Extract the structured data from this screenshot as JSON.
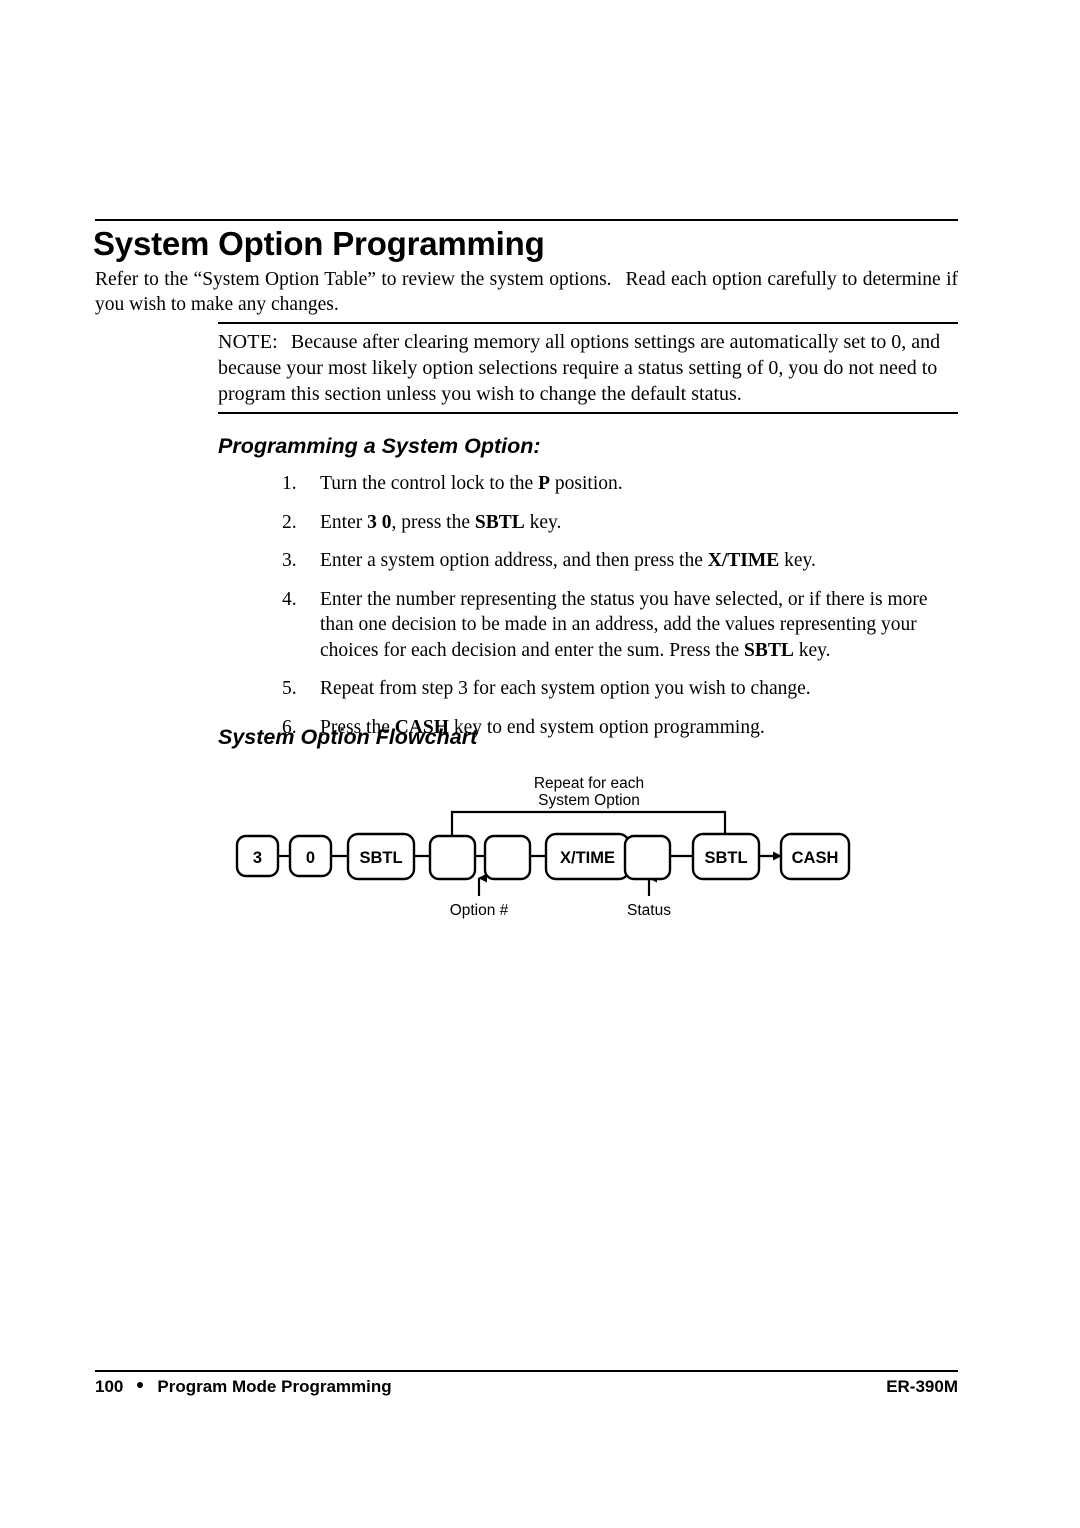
{
  "page": {
    "title": "System Option Programming",
    "intro_part1": "Refer to the “System Option Table” to review the system options.",
    "intro_part2": "Read each option carefully to determine if you wish to make any changes."
  },
  "note": {
    "label": "NOTE:",
    "text": "Because after clearing memory all options settings are automatically set to 0, and because your most likely option selections require a status setting of 0, you do not need to program this section unless you wish to change the default status."
  },
  "section_programming": {
    "heading": "Programming a System Option:",
    "steps": [
      {
        "number": "1.",
        "parts": [
          {
            "text": "Turn the control lock to the ",
            "bold": false
          },
          {
            "text": "P",
            "bold": true
          },
          {
            "text": " position.",
            "bold": false
          }
        ]
      },
      {
        "number": "2.",
        "parts": [
          {
            "text": "Enter ",
            "bold": false
          },
          {
            "text": "3 0",
            "bold": true
          },
          {
            "text": ", press the ",
            "bold": false
          },
          {
            "text": "SBTL",
            "bold": true
          },
          {
            "text": " key.",
            "bold": false
          }
        ]
      },
      {
        "number": "3.",
        "parts": [
          {
            "text": "Enter a system option address, and then press the ",
            "bold": false
          },
          {
            "text": "X/TIME",
            "bold": true
          },
          {
            "text": " key.",
            "bold": false
          }
        ]
      },
      {
        "number": "4.",
        "parts": [
          {
            "text": "Enter the number representing the status you have selected, or if there is more than one decision to be made in an address, add the values representing your choices for each decision and enter the sum. Press the ",
            "bold": false
          },
          {
            "text": "SBTL",
            "bold": true
          },
          {
            "text": " key.",
            "bold": false
          }
        ]
      },
      {
        "number": "5.",
        "parts": [
          {
            "text": "Repeat from step 3 for each system option you wish to change.",
            "bold": false
          }
        ]
      },
      {
        "number": "6.",
        "parts": [
          {
            "text": "Press the ",
            "bold": false
          },
          {
            "text": "CASH",
            "bold": true
          },
          {
            "text": " key to end system option programming.",
            "bold": false
          }
        ]
      }
    ]
  },
  "section_flowchart": {
    "heading": "System Option Flowchart",
    "loop_label_line1": "Repeat for each",
    "loop_label_line2": "System Option",
    "under_labels": [
      {
        "name": "option-number-label",
        "text": "Option #"
      },
      {
        "name": "status-label",
        "text": "Status"
      }
    ],
    "boxes": [
      {
        "name": "key-3",
        "label": "3",
        "blank": false
      },
      {
        "name": "key-0",
        "label": "0",
        "blank": false
      },
      {
        "name": "key-sbtl-first",
        "label": "SBTL",
        "blank": false
      },
      {
        "name": "entry-option-digit-1",
        "label": "",
        "blank": true
      },
      {
        "name": "entry-option-digit-2",
        "label": "",
        "blank": true
      },
      {
        "name": "key-xtime",
        "label": "X/TIME",
        "blank": false
      },
      {
        "name": "entry-status",
        "label": "",
        "blank": true
      },
      {
        "name": "key-sbtl-second",
        "label": "SBTL",
        "blank": false
      },
      {
        "name": "key-cash",
        "label": "CASH",
        "blank": false
      }
    ]
  },
  "footer": {
    "page_number": "100",
    "section": "Program Mode Programming",
    "model": "ER-390M"
  }
}
